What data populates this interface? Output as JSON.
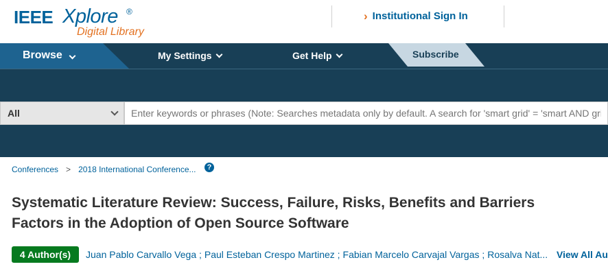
{
  "header": {
    "logo": {
      "ieee": "IEEE",
      "xplore": "Xplore",
      "registered": "®",
      "tagline": "Digital Library"
    },
    "sign_in": {
      "icon": "chevron-right-icon",
      "label": "Institutional Sign In"
    }
  },
  "nav": {
    "items": [
      {
        "label": "Browse"
      },
      {
        "label": "My Settings"
      },
      {
        "label": "Get Help"
      }
    ],
    "subscribe": "Subscribe"
  },
  "search": {
    "scope": "All",
    "placeholder": "Enter keywords or phrases (Note: Searches metadata only by default. A search for 'smart grid' = 'smart AND grid'",
    "value": ""
  },
  "breadcrumb": {
    "items": [
      "Conferences",
      "2018 International Conference..."
    ],
    "separator": ">",
    "help": "?"
  },
  "article": {
    "title_line1": "Systematic Literature Review: Success, Failure, Risks, Benefits and Barriers",
    "title_line2": "Factors in the Adoption of Open Source Software",
    "author_count": "4 Author(s)",
    "authors": [
      "Juan Pablo Carvallo Vega ;",
      "Paul Esteban Crespo Martinez ;",
      "Fabian Marcelo Carvajal Vargas ;",
      "Rosalva Nat..."
    ],
    "view_all": "View All Au"
  },
  "colors": {
    "brand_blue": "#00629b",
    "nav_dark": "#183f56",
    "nav_active": "#1e6390",
    "accent_orange": "#e37222",
    "subscribe_bg": "#c7d7e2",
    "badge_green": "#067a1f"
  }
}
